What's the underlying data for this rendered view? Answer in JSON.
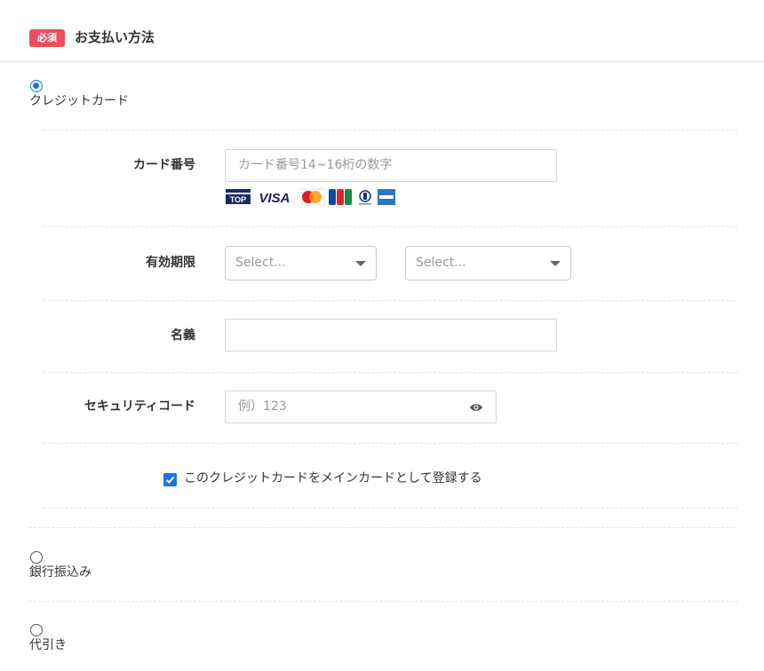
{
  "header": {
    "badge": "必須",
    "title": "お支払い方法"
  },
  "payment_options": [
    {
      "label": "クレジットカード",
      "selected": true
    },
    {
      "label": "銀行振込み",
      "selected": false
    },
    {
      "label": "代引き",
      "selected": false
    }
  ],
  "card_form": {
    "card_number": {
      "label": "カード番号",
      "placeholder": "カード番号14~16桁の数字"
    },
    "card_brands": [
      "TOP",
      "VISA",
      "MasterCard",
      "JCB",
      "Diners Club",
      "AMERICAN EXPRESS"
    ],
    "expiry": {
      "label": "有効期限",
      "month_placeholder": "Select...",
      "year_placeholder": "Select..."
    },
    "name": {
      "label": "名義",
      "value": ""
    },
    "security_code": {
      "label": "セキュリティコード",
      "placeholder": "例）123"
    },
    "main_card": {
      "label": "このクレジットカードをメインカードとして登録する",
      "checked": true
    }
  },
  "colors": {
    "badge": "#e8505b",
    "accent": "#1a73e8"
  }
}
